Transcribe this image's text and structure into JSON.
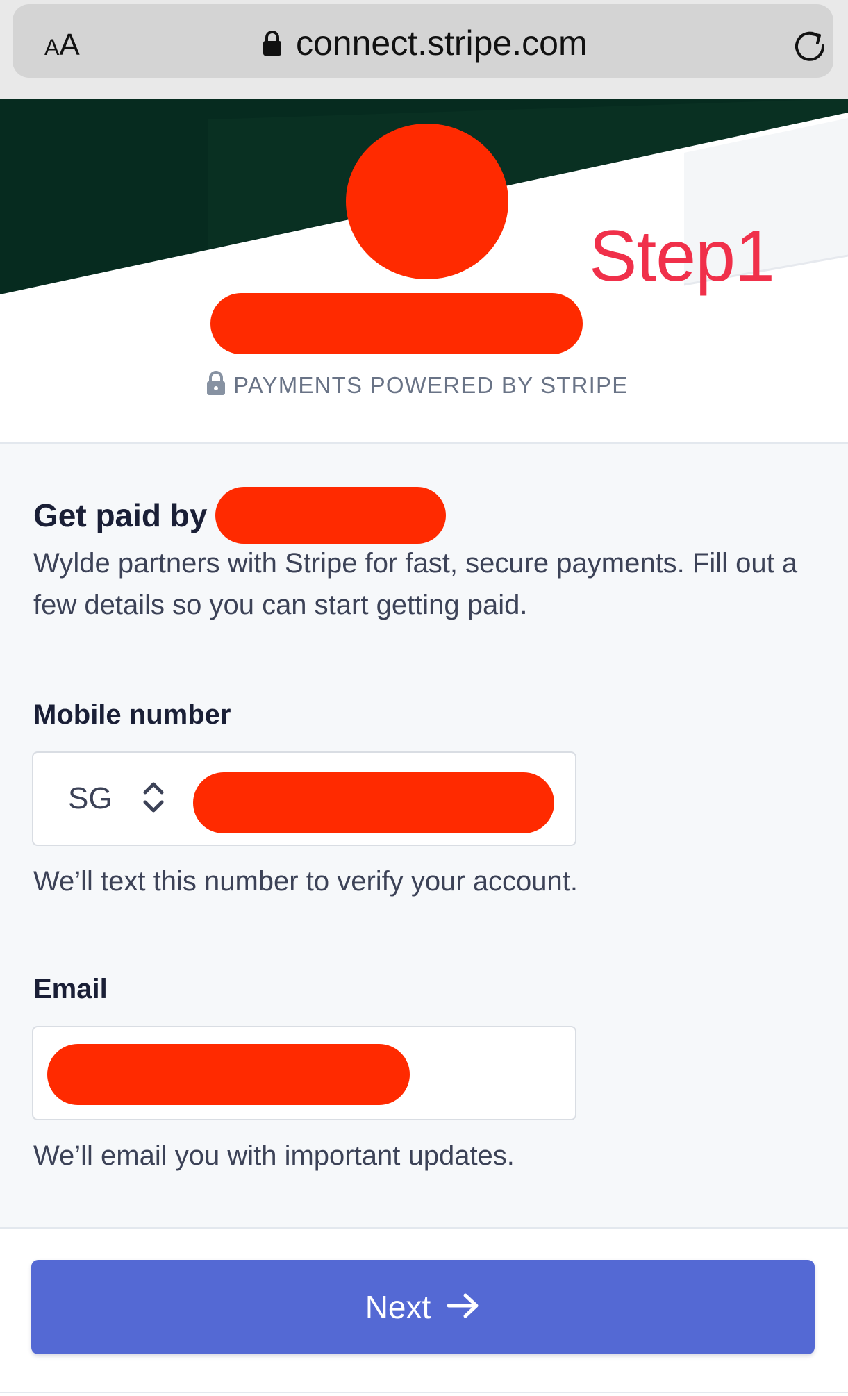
{
  "browser": {
    "aa_label_small": "A",
    "aa_label_large": "A",
    "url": "connect.stripe.com"
  },
  "header": {
    "step_annotation": "Step1",
    "powered_by": "PAYMENTS POWERED BY STRIPE"
  },
  "main": {
    "title": "Get paid by",
    "intro": "Wylde partners with Stripe for fast, secure payments. Fill out a few details so you can start getting paid.",
    "mobile": {
      "label": "Mobile number",
      "country_code": "SG",
      "help": "We’ll text this number to verify your account."
    },
    "email": {
      "label": "Email",
      "help": "We’ll email you with important updates."
    }
  },
  "footer": {
    "next_label": "Next"
  },
  "colors": {
    "redaction": "#ff2a00",
    "banner_dark": "#062b1f",
    "primary_button": "#5469d4",
    "annotation": "#f0304a"
  }
}
